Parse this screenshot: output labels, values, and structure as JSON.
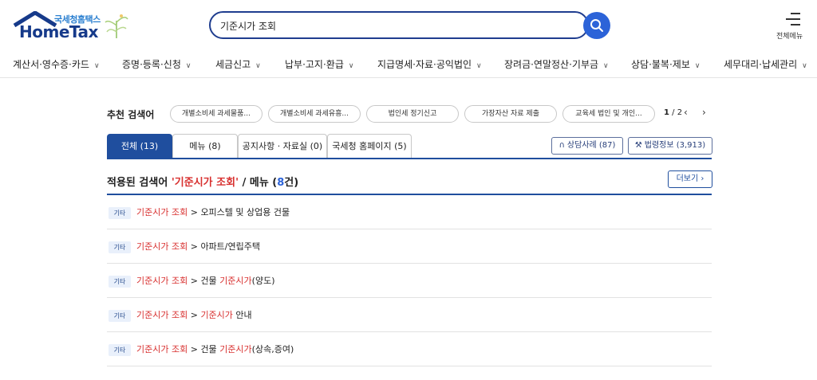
{
  "header": {
    "logo_sub": "국세청홈택스",
    "logo_main": "HomeTax",
    "search_value": "기준시가 조회",
    "all_menu_label": "전체메뉴"
  },
  "nav": {
    "items": [
      {
        "label": "계산서·영수증·카드"
      },
      {
        "label": "증명·등록·신청"
      },
      {
        "label": "세금신고"
      },
      {
        "label": "납부·고지·환급"
      },
      {
        "label": "지급명세·자료·공익법인"
      },
      {
        "label": "장려금·연말정산·기부금"
      },
      {
        "label": "상담·불복·제보"
      },
      {
        "label": "세무대리·납세관리"
      }
    ]
  },
  "recommended": {
    "title": "추천 검색어",
    "chips": [
      "개별소비세 과세물품...",
      "개별소비세 과세유흥...",
      "법인세 정기신고",
      "가장자산 자료 제출",
      "교육세 법인 및 개인..."
    ],
    "page_current": "1",
    "page_sep": " / ",
    "page_total": "2"
  },
  "tabs": [
    {
      "label": "전체 (13)",
      "active": true
    },
    {
      "label": "메뉴 (8)",
      "active": false
    },
    {
      "label": "공지사항 · 자료실 (0)",
      "active": false
    },
    {
      "label": "국세청 홈페이지 (5)",
      "active": false
    }
  ],
  "side_buttons": {
    "consult": "상담사례 (87)",
    "law": "법령정보 (3,913)"
  },
  "result": {
    "prefix": "적용된 검색어 ",
    "keyword": "'기준시가 조회'",
    "middle": " / 메뉴 (",
    "count": "8",
    "suffix": "건)",
    "more_label": "더보기"
  },
  "rows": [
    {
      "badge": "기타",
      "kw": "기준시가 조회",
      "sep": " > ",
      "pre": "오피스텔 및 상업용 건물",
      "hl": "",
      "post": ""
    },
    {
      "badge": "기타",
      "kw": "기준시가 조회",
      "sep": " > ",
      "pre": "아파트/연립주택",
      "hl": "",
      "post": ""
    },
    {
      "badge": "기타",
      "kw": "기준시가 조회",
      "sep": " > ",
      "pre": "건물 ",
      "hl": "기준시가",
      "post": "(양도)"
    },
    {
      "badge": "기타",
      "kw": "기준시가 조회",
      "sep": " > ",
      "pre": "",
      "hl": "기준시가",
      "post": " 안내"
    },
    {
      "badge": "기타",
      "kw": "기준시가 조회",
      "sep": " > ",
      "pre": "건물 ",
      "hl": "기준시가",
      "post": "(상속,증여)"
    }
  ],
  "colors": {
    "primary": "#1f4e9e",
    "highlight": "#d8302f",
    "search_button": "#2c63d8"
  }
}
